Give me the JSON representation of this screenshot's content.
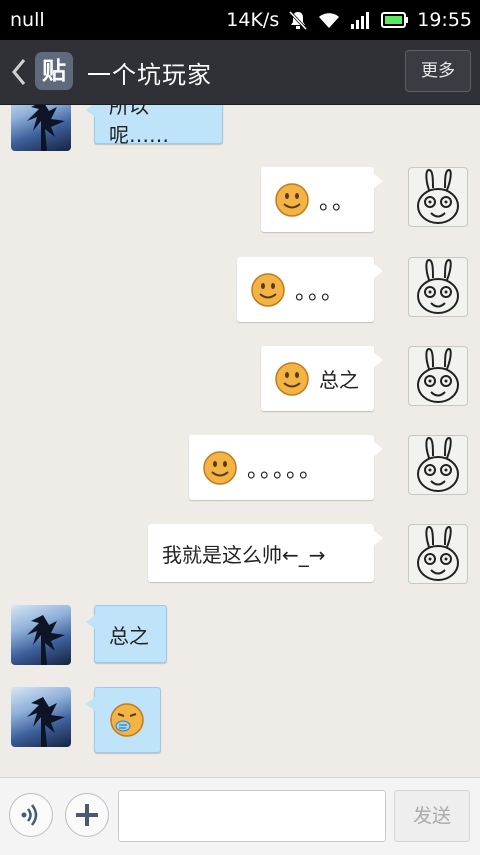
{
  "status_bar": {
    "carrier": "null",
    "network_speed": "14K/s",
    "time": "19:55",
    "icons": [
      "mute-icon",
      "wifi-icon",
      "signal-icon",
      "battery-icon"
    ]
  },
  "header": {
    "back_icon": "chevron-left-icon",
    "app_badge": "贴",
    "title": "一个坑玩家",
    "more_label": "更多"
  },
  "messages": [
    {
      "side": "theirs",
      "text": "所以呢……"
    },
    {
      "side": "mine",
      "emoji": "smile",
      "text": "。。"
    },
    {
      "side": "mine",
      "emoji": "smile",
      "text": "。。。"
    },
    {
      "side": "mine",
      "emoji": "smile",
      "text": "总之"
    },
    {
      "side": "mine",
      "emoji": "smile",
      "text": "。。。。。"
    },
    {
      "side": "mine",
      "text": "我就是这么帅←_→"
    },
    {
      "side": "theirs",
      "text": "总之"
    },
    {
      "side": "theirs",
      "emoji": "sneeze",
      "text": ""
    }
  ],
  "composer": {
    "voice_icon": "voice-icon",
    "plus_icon": "plus-icon",
    "input_value": "",
    "send_label": "发送"
  },
  "colors": {
    "chat_background": "#efebe7",
    "header": "#2f3136",
    "incoming_bubble": "#bfe3f8",
    "outgoing_bubble": "#ffffff"
  }
}
